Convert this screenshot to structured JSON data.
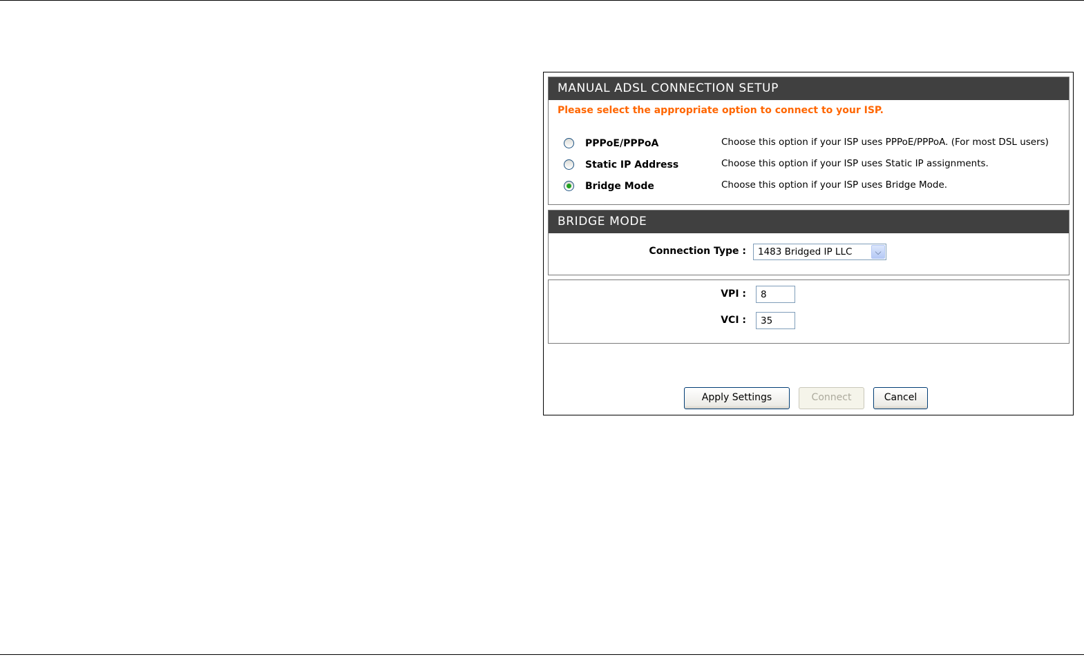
{
  "setup": {
    "title": "MANUAL ADSL CONNECTION SETUP",
    "instruction": "Please select the appropriate option to connect to your ISP.",
    "options": [
      {
        "label": "PPPoE/PPPoA",
        "description": "Choose this option if your ISP uses PPPoE/PPPoA. (For most DSL users)",
        "selected": false
      },
      {
        "label": "Static IP Address",
        "description": "Choose this option if your ISP uses Static IP assignments.",
        "selected": false
      },
      {
        "label": "Bridge Mode",
        "description": "Choose this option if your ISP uses Bridge Mode.",
        "selected": true
      }
    ]
  },
  "bridge": {
    "title": "BRIDGE MODE",
    "connection_type_label": "Connection Type :",
    "connection_type_value": "1483 Bridged IP LLC"
  },
  "atm": {
    "vpi_label": "VPI :",
    "vpi_value": "8",
    "vci_label": "VCI :",
    "vci_value": "35"
  },
  "buttons": {
    "apply": "Apply Settings",
    "connect": "Connect",
    "cancel": "Cancel"
  },
  "icons": {
    "dropdown": "chevron-down-icon"
  },
  "colors": {
    "header_bg": "#404040",
    "instruction": "#ff6600",
    "radio_selected": "#21a121"
  }
}
